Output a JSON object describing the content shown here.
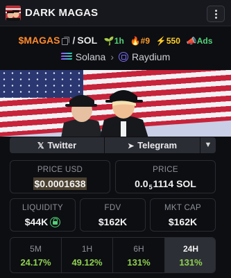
{
  "header": {
    "title": "DARK MAGAS",
    "menu_icon": "kebab-menu-icon"
  },
  "token": {
    "symbol": "$MAGAS",
    "separator": "/",
    "quote": "SOL",
    "age": "1h",
    "rank": "#9",
    "boosts": "550",
    "ads": "Ads"
  },
  "chain": {
    "network": "Solana",
    "dex": "Raydium"
  },
  "social": {
    "twitter": "Twitter",
    "telegram": "Telegram"
  },
  "stats": {
    "price_usd_label": "PRICE USD",
    "price_usd": "$0.0001638",
    "price_label": "PRICE",
    "price_sol_prefix": "0.0",
    "price_sol_zeros": "5",
    "price_sol_rest": "1114 SOL",
    "liquidity_label": "LIQUIDITY",
    "liquidity": "$44K",
    "fdv_label": "FDV",
    "fdv": "$162K",
    "mktcap_label": "MKT CAP",
    "mktcap": "$162K"
  },
  "changes": [
    {
      "label": "5M",
      "value": "24.17%"
    },
    {
      "label": "1H",
      "value": "49.12%"
    },
    {
      "label": "6H",
      "value": "131%"
    },
    {
      "label": "24H",
      "value": "131%"
    }
  ],
  "colors": {
    "accent": "#ff8a2a",
    "positive": "#8fd14f",
    "background": "#0d0e12"
  }
}
